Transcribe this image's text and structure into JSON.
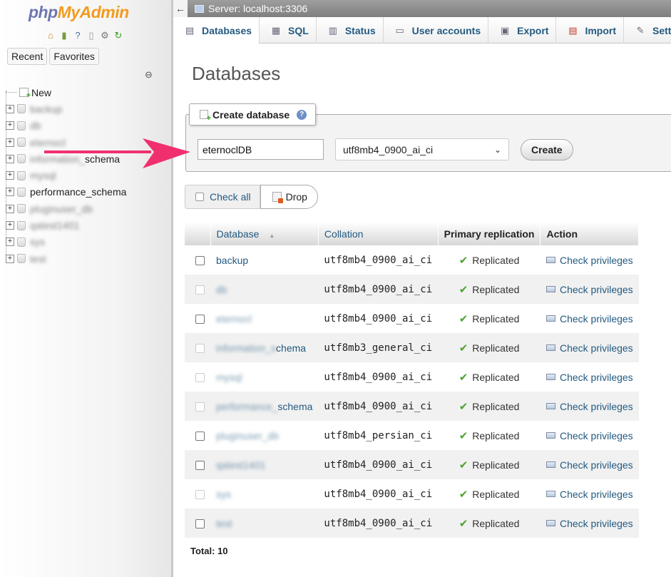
{
  "nav": {
    "logo_php": "php",
    "logo_admin": "MyAdmin",
    "tab_recent": "Recent",
    "tab_favorites": "Favorites",
    "tree_new": "New",
    "tree_items": [
      {
        "label": "backup",
        "blurred": true
      },
      {
        "label": "db",
        "blurred": true
      },
      {
        "label": "eternocl",
        "blurred": true
      },
      {
        "label": "information_schema",
        "blurred": false,
        "visible_suffix": "schema"
      },
      {
        "label": "mysql",
        "blurred": true
      },
      {
        "label": "performance_schema",
        "blurred": false
      },
      {
        "label": "pluginuser_db",
        "blurred": true
      },
      {
        "label": "qatest1401",
        "blurred": true
      },
      {
        "label": "sys",
        "blurred": true
      },
      {
        "label": "test",
        "blurred": true
      }
    ]
  },
  "serverbar": {
    "back": "←",
    "title": "Server: localhost:3306"
  },
  "tabs": [
    {
      "label": "Databases",
      "icon": "database-icon"
    },
    {
      "label": "SQL",
      "icon": "sql-icon"
    },
    {
      "label": "Status",
      "icon": "status-icon"
    },
    {
      "label": "User accounts",
      "icon": "users-icon"
    },
    {
      "label": "Export",
      "icon": "export-icon"
    },
    {
      "label": "Import",
      "icon": "import-icon"
    },
    {
      "label": "Settings",
      "icon": "wrench-icon"
    }
  ],
  "main": {
    "title": "Databases",
    "create": {
      "legend": "Create database",
      "name_value": "eternoclDB",
      "collation_value": "utf8mb4_0900_ai_ci",
      "create_label": "Create"
    },
    "check_all_label": "Check all",
    "drop_label": "Drop",
    "table": {
      "headers": [
        "Database",
        "Collation",
        "Primary replication",
        "Action"
      ],
      "sort_indicator": "▲",
      "rows": [
        {
          "name": "backup",
          "collation": "utf8mb4_0900_ai_ci",
          "replication": "Replicated",
          "action": "Check privileges"
        },
        {
          "name": "db",
          "collation": "utf8mb4_0900_ai_ci",
          "replication": "Replicated",
          "action": "Check privileges"
        },
        {
          "name": "eternocl",
          "collation": "utf8mb4_0900_ai_ci",
          "replication": "Replicated",
          "action": "Check privileges"
        },
        {
          "name": "information_schema",
          "visible": "chema",
          "collation": "utf8mb3_general_ci",
          "replication": "Replicated",
          "action": "Check privileges"
        },
        {
          "name": "mysql",
          "collation": "utf8mb4_0900_ai_ci",
          "replication": "Replicated",
          "action": "Check privileges"
        },
        {
          "name": "performance_schema",
          "visible": "schema",
          "collation": "utf8mb4_0900_ai_ci",
          "replication": "Replicated",
          "action": "Check privileges"
        },
        {
          "name": "pluginuser_db",
          "collation": "utf8mb4_persian_ci",
          "replication": "Replicated",
          "action": "Check privileges"
        },
        {
          "name": "qatest1401",
          "collation": "utf8mb4_0900_ai_ci",
          "replication": "Replicated",
          "action": "Check privileges"
        },
        {
          "name": "sys",
          "collation": "utf8mb4_0900_ai_ci",
          "replication": "Replicated",
          "action": "Check privileges"
        },
        {
          "name": "test",
          "collation": "utf8mb4_0900_ai_ci",
          "replication": "Replicated",
          "action": "Check privileges"
        }
      ]
    },
    "total": "Total: 10"
  },
  "colors": {
    "link": "#235a81",
    "arrow": "#f0306e",
    "ok": "#4ca32f"
  }
}
